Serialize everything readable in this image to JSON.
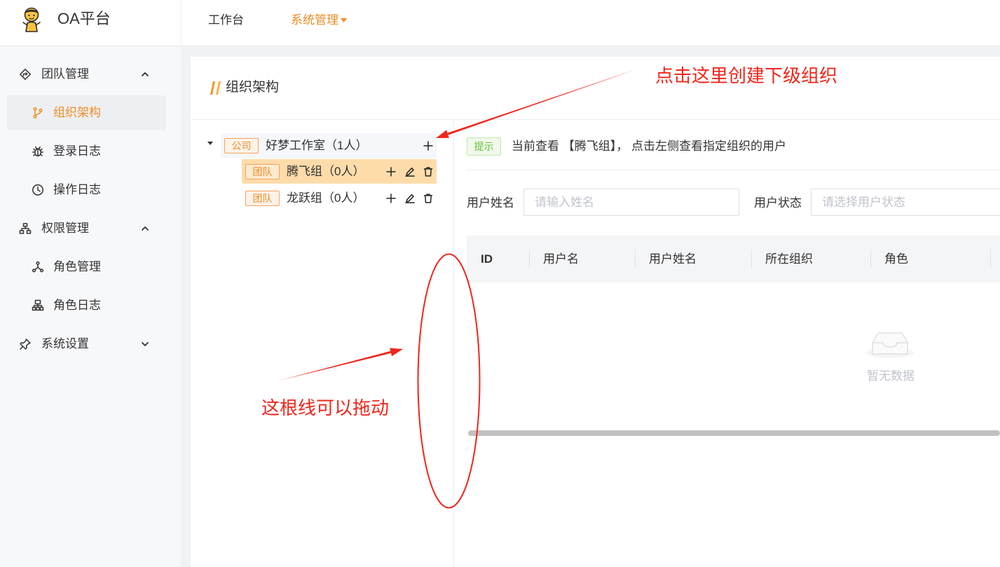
{
  "header": {
    "app_title": "OA平台",
    "logo_icon": "mascot-logo-icon",
    "nav": [
      {
        "label": "工作台",
        "active": false
      },
      {
        "label": "系统管理",
        "active": true,
        "icon": "caret-down-icon"
      }
    ]
  },
  "sidebar": {
    "groups": [
      {
        "label": "团队管理",
        "icon": "diamond-icon",
        "toggle_icon": "chevron-up-icon",
        "expanded": true,
        "items": [
          {
            "label": "组织架构",
            "icon": "branch-icon",
            "selected": true
          },
          {
            "label": "登录日志",
            "icon": "bug-icon"
          },
          {
            "label": "操作日志",
            "icon": "clock-icon"
          }
        ]
      },
      {
        "label": "权限管理",
        "icon": "sitemap-icon",
        "toggle_icon": "chevron-up-icon",
        "expanded": true,
        "items": [
          {
            "label": "角色管理",
            "icon": "nodes-icon"
          },
          {
            "label": "角色日志",
            "icon": "org-chart-icon"
          }
        ]
      },
      {
        "label": "系统设置",
        "icon": "pin-icon",
        "toggle_icon": "chevron-down-icon",
        "expanded": false,
        "items": []
      }
    ]
  },
  "page": {
    "title": "组织架构"
  },
  "org_tree": {
    "root": {
      "tag": "公司",
      "name": "好梦工作室（1人）",
      "expanded": true,
      "actions": [
        "plus-icon"
      ],
      "children": [
        {
          "tag": "团队",
          "name": "腾飞组（0人）",
          "selected": true,
          "actions": [
            "plus-icon",
            "edit-icon",
            "delete-icon"
          ]
        },
        {
          "tag": "团队",
          "name": "龙跃组（0人）",
          "actions": [
            "plus-icon",
            "edit-icon",
            "delete-icon"
          ]
        }
      ]
    }
  },
  "notice": {
    "tag": "提示",
    "text": "当前查看 【腾飞组】， 点击左侧查看指定组织的用户"
  },
  "filters": [
    {
      "label": "用户姓名",
      "placeholder": "请输入姓名"
    },
    {
      "label": "用户状态",
      "placeholder": "请选择用户状态"
    }
  ],
  "table": {
    "columns": [
      "ID",
      "用户名",
      "用户姓名",
      "所在组织",
      "角色"
    ],
    "empty_icon": "inbox-icon",
    "empty_text": "暂无数据"
  },
  "annotations": {
    "create_hint": "点击这里创建下级组织",
    "drag_hint": "这根线可以拖动"
  },
  "colors": {
    "accent": "#f08c26",
    "selected_node_bg": "#fedcaa",
    "notice_green": "#67c23a",
    "annotation_red": "#f0261c"
  }
}
